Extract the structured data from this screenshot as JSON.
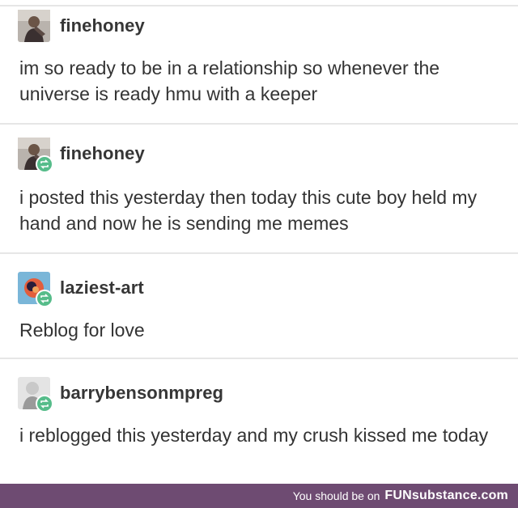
{
  "posts": [
    {
      "username": "finehoney",
      "text": "im so ready to be in a relationship so whenever the universe is ready hmu with a keeper",
      "avatar_icon": "person-photo-icon",
      "reblogged": false
    },
    {
      "username": "finehoney",
      "text": "i posted this yesterday then today this cute boy held my hand and now he is sending me memes",
      "avatar_icon": "person-photo-icon",
      "reblogged": true
    },
    {
      "username": "laziest-art",
      "text": "Reblog for love",
      "avatar_icon": "art-logo-icon",
      "reblogged": true
    },
    {
      "username": "barrybensonmpreg",
      "text": "i reblogged this yesterday and my crush kissed me today",
      "avatar_icon": "person-photo-icon",
      "reblogged": true
    }
  ],
  "footer": {
    "prefix": "You should be on",
    "brand": "FUNsubstance.com"
  },
  "colors": {
    "footer_bg": "#6e4b72",
    "reblog_badge": "#56bc8a",
    "divider": "#e6e6e6"
  }
}
